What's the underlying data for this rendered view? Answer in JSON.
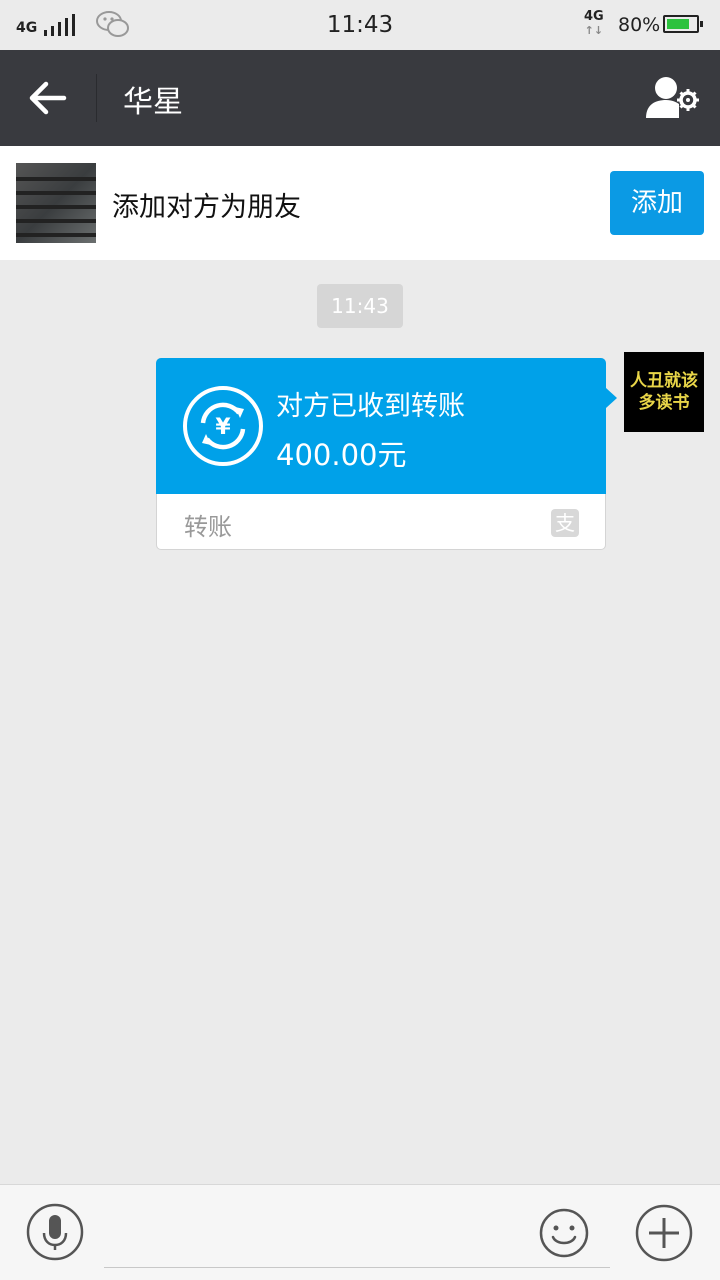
{
  "status_bar": {
    "network_left": "4G",
    "time": "11:43",
    "network_right": "4G",
    "network_right_arrows": "↑↓",
    "battery_percent": "80%",
    "battery_level": 0.8,
    "battery_color": "#2cc23e"
  },
  "header": {
    "title": "华星"
  },
  "banner": {
    "text": "添加对方为朋友",
    "add_label": "添加"
  },
  "chat": {
    "timestamp": "11:43",
    "transfer": {
      "status": "对方已收到转账",
      "amount": "400.00元",
      "label": "转账",
      "alipay_glyph": "支"
    },
    "self_avatar_lines": [
      "人丑就该",
      "多读书"
    ]
  },
  "colors": {
    "header_bg": "#393a3f",
    "accent": "#0b9ae4",
    "bubble": "#00a1e9"
  },
  "icons": {
    "back": "arrow-left-icon",
    "profile": "user-settings-icon",
    "transfer": "currency-exchange-icon",
    "voice": "microphone-icon",
    "emoji": "smiley-icon",
    "more": "plus-icon"
  }
}
